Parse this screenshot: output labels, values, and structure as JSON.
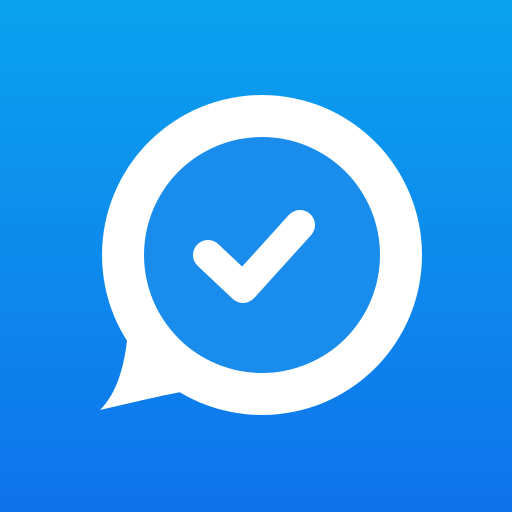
{
  "icon": {
    "name": "chat-bubble-check-icon",
    "colors": {
      "gradient_top": "#0aa2ee",
      "gradient_bottom": "#0f73ec",
      "bubble": "#ffffff",
      "inner_circle": "#1a8ceb",
      "checkmark": "#ffffff"
    }
  }
}
